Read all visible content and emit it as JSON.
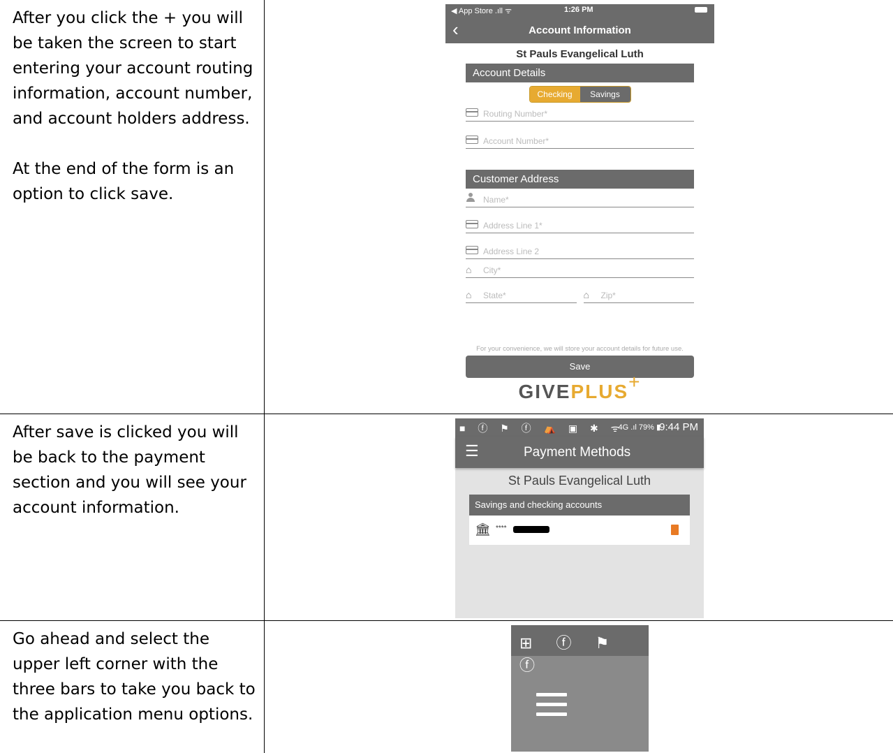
{
  "rows": [
    {
      "text": [
        "After you click the + you will be taken the screen to start entering your account routing information, account number, and account holders address.",
        "At the end of the form is an option to click save."
      ]
    },
    {
      "text": [
        "After save is clicked you will be back to the payment section and you will see your account information."
      ]
    },
    {
      "text": [
        "Go ahead and select the upper left corner with the three bars to take you back to the application menu options."
      ]
    }
  ],
  "ios_screen": {
    "carrier": "◀ App Store .ıll ᯤ",
    "time": "1:26 PM",
    "title": "Account Information",
    "org": "St Pauls Evangelical Luth",
    "account_details": "Account Details",
    "checking": "Checking",
    "savings": "Savings",
    "routing_placeholder": "Routing Number*",
    "account_placeholder": "Account Number*",
    "customer_address": "Customer Address",
    "name_placeholder": "Name*",
    "address1_placeholder": "Address Line 1*",
    "address2_placeholder": "Address Line 2",
    "city_placeholder": "City*",
    "state_placeholder": "State*",
    "zip_placeholder": "Zip*",
    "notice": "For your convenience, we will store your account details for future use.",
    "save": "Save",
    "logo_give": "GIVE",
    "logo_plus": "PLUS",
    "logo_cross": "+"
  },
  "android_screen": {
    "status_icons": "■ ⓕ ⚑ ⓕ ⛺ ▣ ✱ ᯤ",
    "battery": "4G .ıl 79% ▮",
    "time": "9:44 PM",
    "title": "Payment Methods",
    "org": "St Pauls Evangelical Luth",
    "list_header": "Savings and checking accounts",
    "account_mask": "****"
  },
  "crop_screen": {
    "icons": "⊞ ⓕ ⚑ ⓕ"
  },
  "colors": {
    "app_gray": "#6b6b6b",
    "accent_gold": "#e7aa31",
    "trash_orange": "#e87a24"
  }
}
